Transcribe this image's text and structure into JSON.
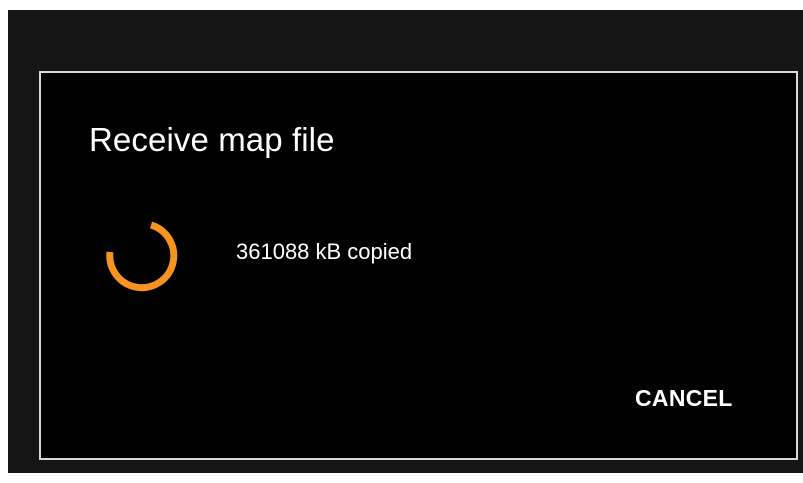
{
  "dialog": {
    "title": "Receive map file",
    "status_text": "361088 kB copied",
    "cancel_label": "CANCEL"
  },
  "icons": {
    "progress": "progress-spinner-icon"
  },
  "colors": {
    "screen_background": "#151515",
    "dialog_background": "#000000",
    "dialog_border": "#d9d9d9",
    "text": "#ffffff",
    "accent": "#f7931e"
  }
}
